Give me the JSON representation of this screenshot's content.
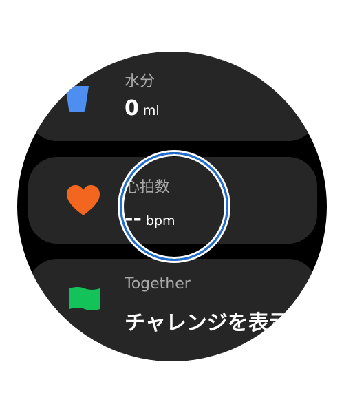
{
  "tiles": {
    "water": {
      "label": "水分",
      "value": "0",
      "unit": "ml",
      "icon": "water-cup-icon",
      "color": "#4d8ef0"
    },
    "heart": {
      "label": "心拍数",
      "value": "--",
      "unit": "bpm",
      "icon": "heart-icon",
      "color": "#f2661f"
    },
    "together": {
      "label": "Together",
      "value": "チャレンジを表示",
      "icon": "flag-icon",
      "color": "#14c25a"
    }
  },
  "colors": {
    "card": "#262626",
    "background": "#000000",
    "focus_ring": "#1e6fd0"
  }
}
